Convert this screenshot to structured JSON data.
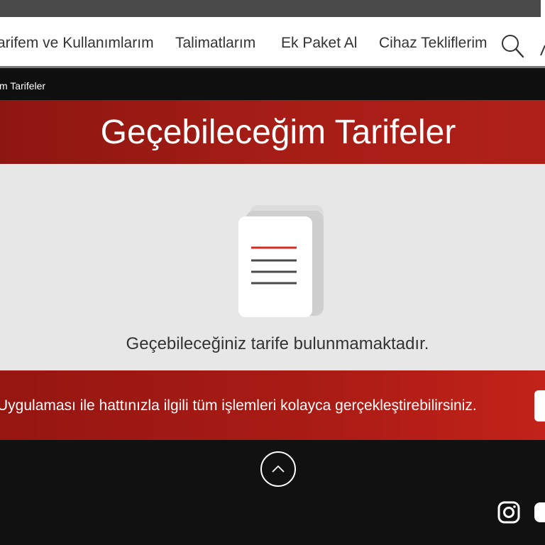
{
  "nav": {
    "items": [
      {
        "label": "arifem ve Kullanımlarım"
      },
      {
        "label": "Talimatlarım"
      },
      {
        "label": "Ek Paket Al"
      },
      {
        "label": "Cihaz Tekliflerim"
      }
    ],
    "search_icon": "search-icon",
    "user_icon": "user-icon"
  },
  "breadcrumb": {
    "current": "m Tarifeler"
  },
  "hero": {
    "title": "Geçebileceğim Tarifeler"
  },
  "empty_state": {
    "icon": "document-icon",
    "message": "Geçebileceğiniz tarife bulunmamaktadır."
  },
  "app_banner": {
    "text": "Uygulaması ile hattınızla ilgili tüm işlemleri kolayca gerçekleştirebilirsiniz."
  },
  "footer": {
    "scroll_top_icon": "chevron-up-icon",
    "social": [
      "instagram-icon",
      "youtube-icon"
    ]
  },
  "colors": {
    "brand_red": "#a51d16",
    "nav_text": "#333333",
    "empty_bg": "#e7e7e7",
    "dark_bg": "#111111"
  }
}
